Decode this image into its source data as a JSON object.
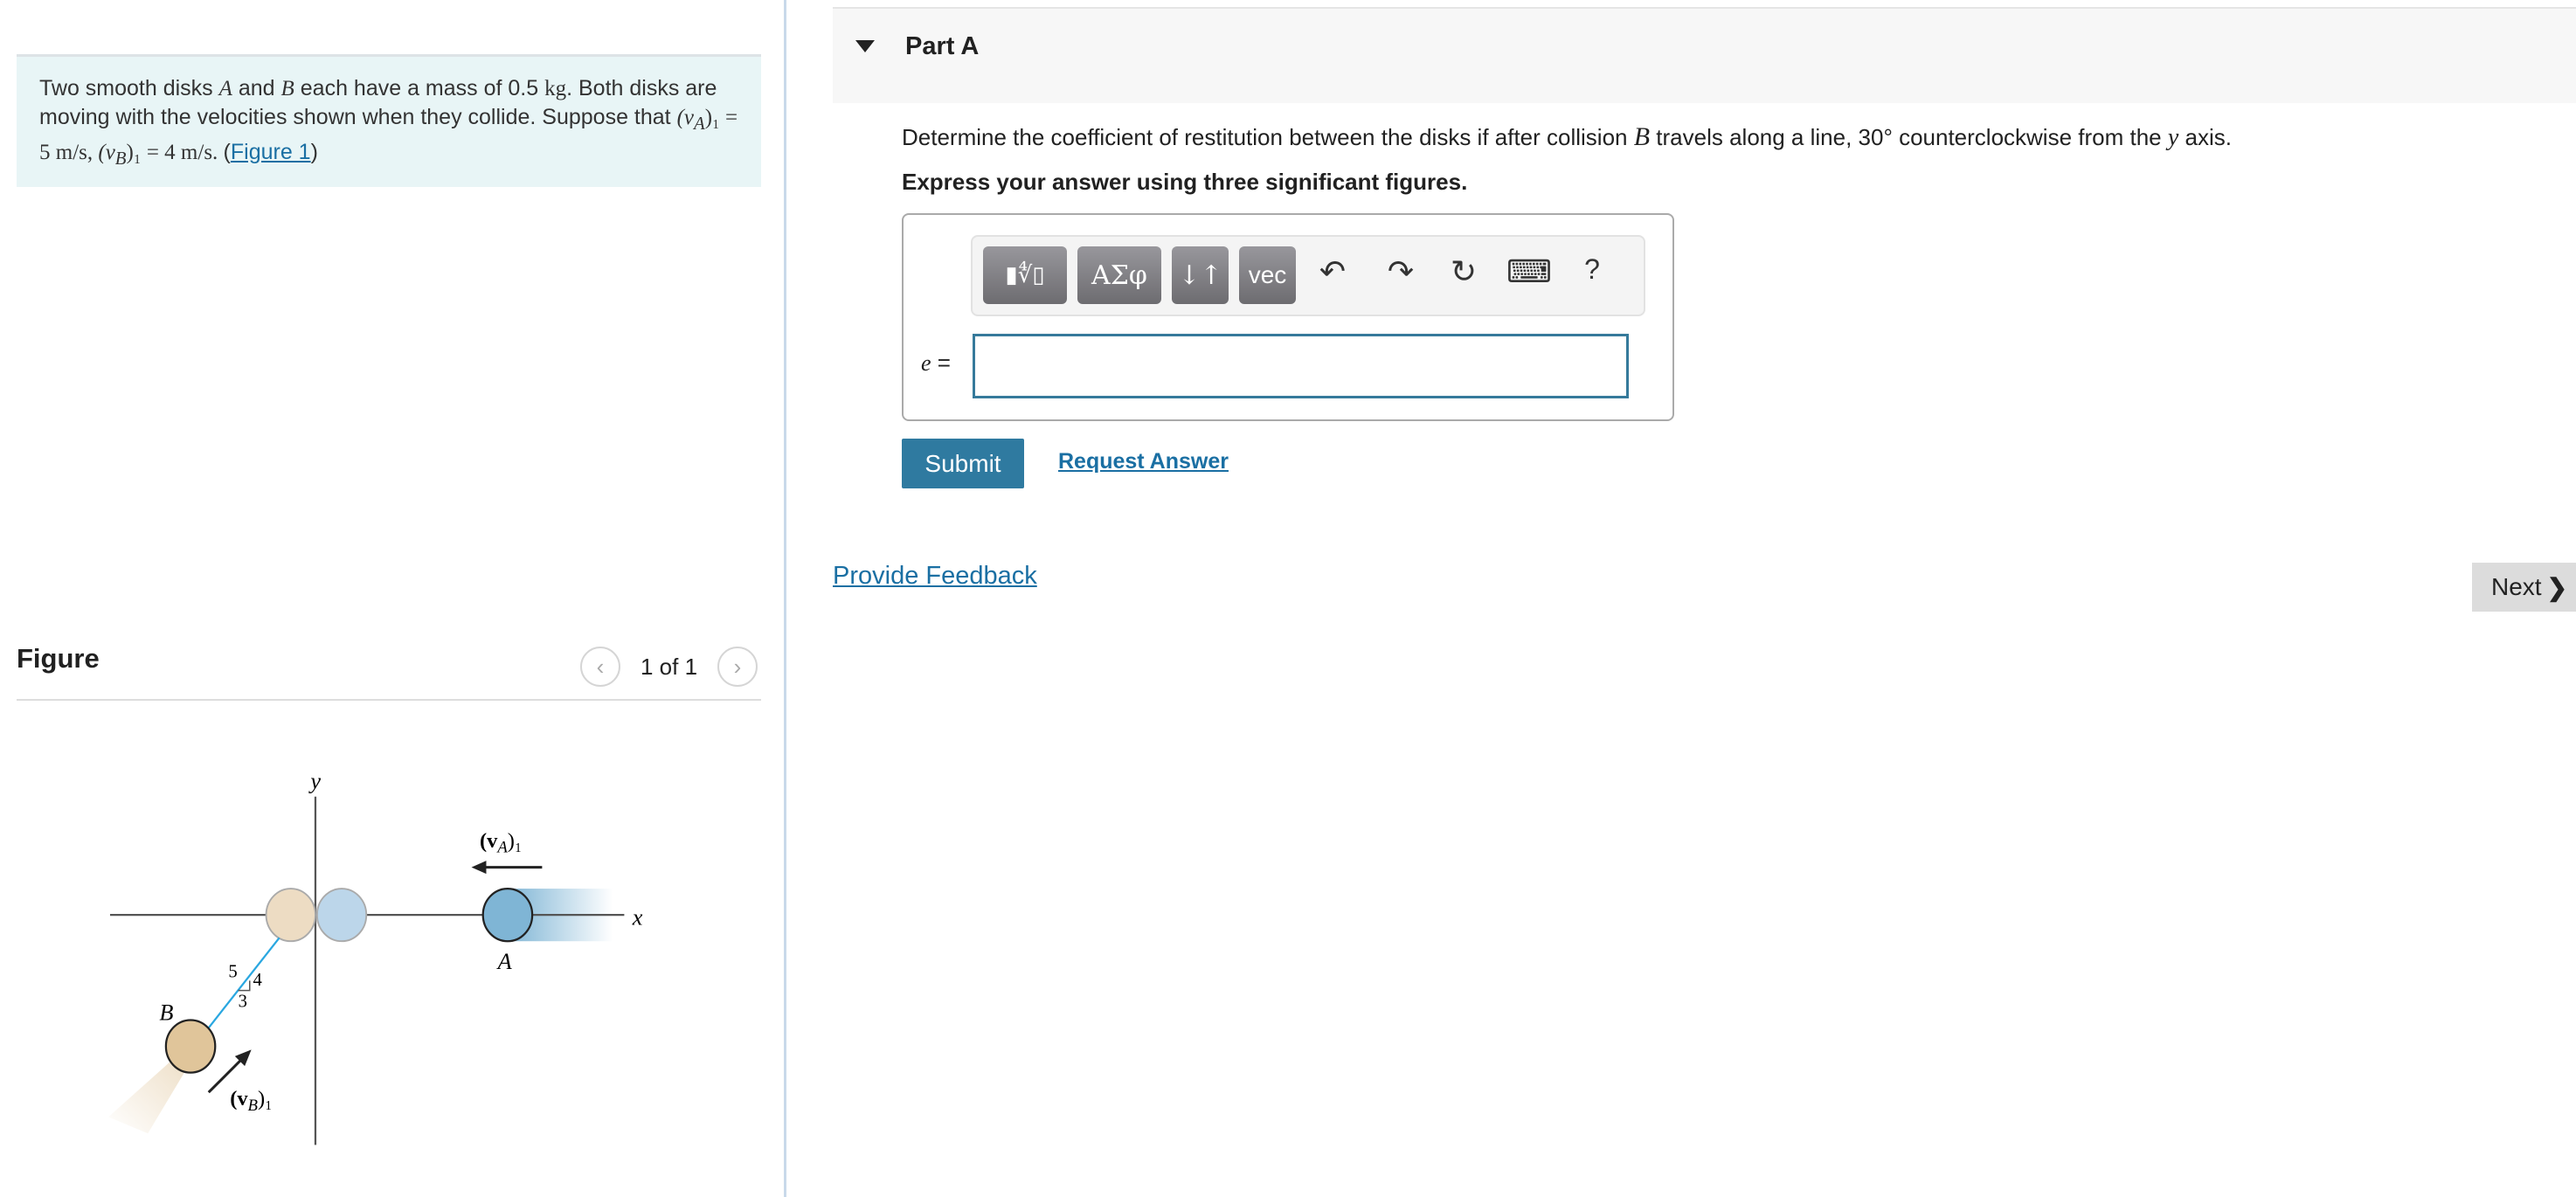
{
  "problem": {
    "text_1": "Two smooth disks ",
    "A": "A",
    " and": " and ",
    "B": "B",
    "text_2": " each have a mass of 0.5 ",
    "kg": "kg",
    "text_3": ". Both disks are moving with the velocities shown when they collide. Suppose that ",
    "vA": "(v",
    "vA_sub": "A",
    "vA_end": ")₁ = 5 m/s, ",
    "vB": "(v",
    "vB_sub": "B",
    "vB_end": ")₁ = 4 m/s. ",
    "open": "(",
    "link": "Figure 1",
    "close": ")"
  },
  "figure_panel": {
    "label": "Figure",
    "pager": "1 of 1",
    "prev_icon": "chevron-left",
    "next_icon": "chevron-right"
  },
  "figure": {
    "x": "x",
    "y": "y",
    "A": "A",
    "B": "B",
    "vA": "(v",
    "vA_sub": "A",
    "vA_end": ")₁",
    "vB": "(v",
    "vB_sub": "B",
    "vB_end": ")₁",
    "n5": "5",
    "n4": "4",
    "n3": "3"
  },
  "part": {
    "title": "Part A",
    "question_1": "Determine the coefficient of restitution between the disks if after collision ",
    "question_B": "B",
    "question_2": " travels along a line, 30° counterclockwise from the ",
    "question_y": "y",
    "question_3": " axis.",
    "express": "Express your answer using three significant figures."
  },
  "toolbar": {
    "templates": "▮∜▯",
    "greek": "ΑΣφ",
    "arrows": "↓↑",
    "vec": "vec",
    "undo": "↶",
    "redo": "↷",
    "reset": "↻",
    "keyboard": "⌨",
    "help": "?"
  },
  "answer": {
    "label": "e",
    "equals": " =",
    "value": ""
  },
  "buttons": {
    "submit": "Submit",
    "request": "Request Answer",
    "feedback": "Provide Feedback",
    "next": "Next",
    "next_icon": "❯"
  },
  "colors": {
    "accent": "#2f7aa0",
    "link": "#1a6fa3",
    "problem_bg": "#e8f5f6",
    "disk_A": "#7fb5d5",
    "disk_B": "#e0c59a"
  }
}
